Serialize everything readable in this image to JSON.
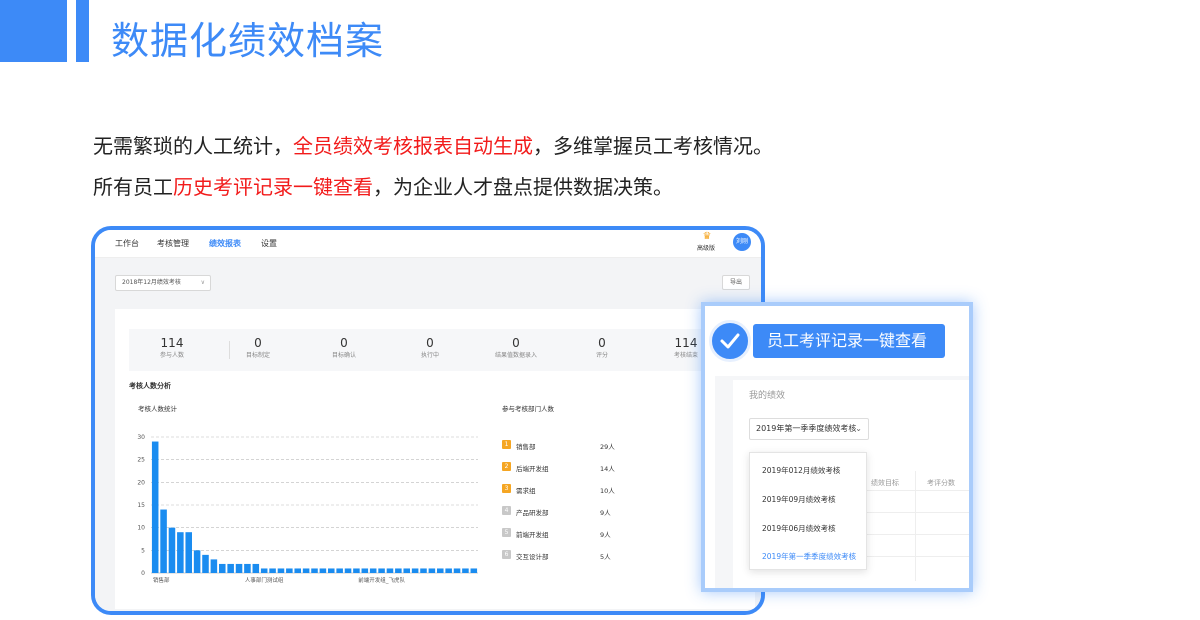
{
  "slide": {
    "title": "数据化绩效档案",
    "line1": {
      "a": "无需繁琐的人工统计，",
      "b": "全员绩效考核报表自动生成",
      "c": "，多维掌握员工考核情况。"
    },
    "line2": {
      "a": "所有员工",
      "b": "历史考评记录一键查看",
      "c": "，为企业人才盘点提供数据决策。"
    }
  },
  "colors": {
    "accent": "#3d8af7",
    "highlight": "#f21b1b",
    "orange": "#f5a623"
  },
  "app": {
    "nav": [
      "工作台",
      "考核管理",
      "绩效报表",
      "设置"
    ],
    "active_nav": "绩效报表",
    "crown_icon": "crown-icon",
    "level": "高级版",
    "avatar_text": "刘刚",
    "period_select": "2018年12月绩效考核",
    "export_label": "导出",
    "stats": [
      {
        "value": "114",
        "label": "参与人数"
      },
      {
        "value": "0",
        "label": "目标制定"
      },
      {
        "value": "0",
        "label": "目标确认"
      },
      {
        "value": "0",
        "label": "执行中"
      },
      {
        "value": "0",
        "label": "结果值数据录入"
      },
      {
        "value": "0",
        "label": "评分"
      },
      {
        "value": "114",
        "label": "考核结束"
      }
    ],
    "section_title": "考核人数分析",
    "chart_title": "考核人数统计",
    "dept_title": "参与考核部门人数",
    "departments": [
      {
        "rank": "1",
        "name": "销售部",
        "count": "29人"
      },
      {
        "rank": "2",
        "name": "后端开发组",
        "count": "14人"
      },
      {
        "rank": "3",
        "name": "需求组",
        "count": "10人"
      },
      {
        "rank": "4",
        "name": "产品研发部",
        "count": "9人"
      },
      {
        "rank": "5",
        "name": "前端开发组",
        "count": "9人"
      },
      {
        "rank": "6",
        "name": "交互设计部",
        "count": "5人"
      }
    ]
  },
  "chart_data": {
    "type": "bar",
    "title": "考核人数统计",
    "xlabel": "",
    "ylabel": "",
    "ylim": [
      0,
      30
    ],
    "yticks": [
      0,
      5,
      10,
      15,
      20,
      25,
      30
    ],
    "visible_category_labels": [
      {
        "index": 0,
        "label": "销售部"
      },
      {
        "index": 13,
        "label": "人事部门测试组"
      },
      {
        "index": 27,
        "label": "前端开发组_飞虎队"
      }
    ],
    "values": [
      29,
      14,
      10,
      9,
      9,
      5,
      4,
      3,
      2,
      2,
      2,
      2,
      2,
      1,
      1,
      1,
      1,
      1,
      1,
      1,
      1,
      1,
      1,
      1,
      1,
      1,
      1,
      1,
      1,
      1,
      1,
      1,
      1,
      1,
      1,
      1,
      1,
      1,
      1
    ],
    "bar_color": "#1a8cf0",
    "grid": "dashed horizontal"
  },
  "overlay": {
    "badge": "员工考评记录一键查看",
    "check_icon": "check-icon",
    "my_perf": "我的绩效",
    "select": "2019年第一季季度绩效考核",
    "table_headers": [
      "绩效目标",
      "考评分数"
    ],
    "options": [
      "2019年012月绩效考核",
      "2019年09月绩效考核",
      "2019年06月绩效考核",
      "2019年第一季季度绩效考核"
    ],
    "selected_option": "2019年第一季季度绩效考核"
  }
}
